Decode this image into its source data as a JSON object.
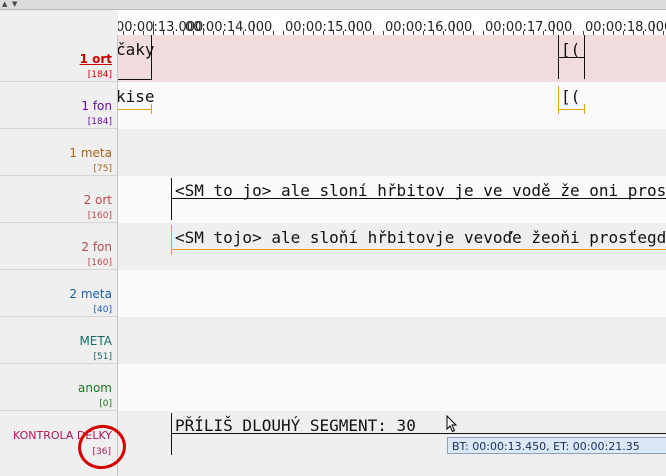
{
  "ruler": {
    "labels": [
      "00:00:13.000",
      "00:00:14.000",
      "00:00:15.000",
      "00:00:16.000",
      "00:00:17.000",
      "00:00:18.000"
    ]
  },
  "tiers": [
    {
      "name": "1 ort",
      "count": "[184]",
      "color": "#cc0000",
      "bold": true,
      "underline": true
    },
    {
      "name": "1 fon",
      "count": "[184]",
      "color": "#6a0aa8"
    },
    {
      "name": "1 meta",
      "count": "[75]",
      "color": "#a86414"
    },
    {
      "name": "2 ort",
      "count": "[160]",
      "color": "#b84a4a"
    },
    {
      "name": "2 fon",
      "count": "[160]",
      "color": "#b84a4a"
    },
    {
      "name": "2 meta",
      "count": "[40]",
      "color": "#1b5ea8"
    },
    {
      "name": "META",
      "count": "[51]",
      "color": "#1a6a6a"
    },
    {
      "name": "anom",
      "count": "[0]",
      "color": "#1a7a1a"
    },
    {
      "name": "KONTROLA DÉLKY",
      "count": "[36]",
      "color": "#b0135a"
    }
  ],
  "segments": {
    "ort1_a": "čaky",
    "ort1_b": "[(",
    "fon1_a": "kise",
    "fon1_b": "[(",
    "ort2": "<SM to jo> ale sloní hřbitov je ve vodě že oni prostě ko",
    "fon2": "<SM tojo> ale sloňí hřbitovje vevoďe žeoňi prosťegdi u",
    "kontrola": "PŘÍLIŠ DLOUHÝ SEGMENT: 30"
  },
  "tooltip": "BT: 00:00:13.450, ET: 00:00:21.35",
  "colors": {
    "ort_tier_bg": "#f0dcdc",
    "ort_boundary": "#111111",
    "fon_boundary": "#e3a019",
    "row_light": "#fafafa",
    "row_dark": "#efefef",
    "annotation_circle": "#d40000"
  }
}
